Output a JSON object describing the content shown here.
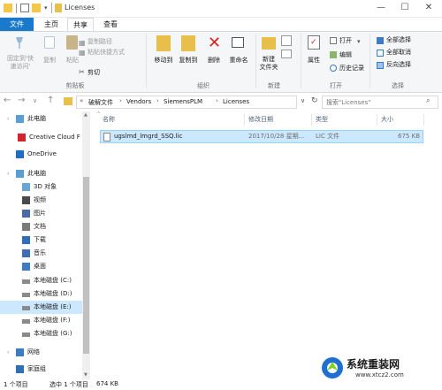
{
  "window": {
    "title": "Licenses",
    "controls": [
      "—",
      "☐",
      "✕"
    ]
  },
  "tabs": [
    {
      "label": "文件"
    },
    {
      "label": "主页"
    },
    {
      "label": "共享"
    },
    {
      "label": "查看"
    }
  ],
  "ribbon": {
    "clipboard": {
      "group_label": "剪贴板",
      "pin_label_1": "固定到'快",
      "pin_label_2": "速访问'",
      "copy_label": "复制",
      "paste_label": "粘贴",
      "cut_label": "剪切",
      "copy_path_label": "复制路径",
      "paste_shortcut_label": "粘贴快捷方式"
    },
    "organize": {
      "group_label": "组织",
      "move_to_label": "移动到",
      "copy_to_label": "复制到",
      "delete_label": "删除",
      "rename_label": "重命名"
    },
    "new": {
      "group_label": "新建",
      "new_folder_label_1": "新建",
      "new_folder_label_2": "文件夹"
    },
    "open": {
      "group_label": "打开",
      "properties_label": "属性",
      "open_label": "打开",
      "edit_label": "编辑",
      "history_label": "历史记录"
    },
    "select": {
      "group_label": "选择",
      "select_all_label": "全部选择",
      "select_none_label": "全部取消",
      "invert_label": "反向选择"
    }
  },
  "address": {
    "crumbs": [
      "破解文件",
      "Vendors",
      "SiemensPLM",
      "Licenses"
    ],
    "search_placeholder": "搜索\"Licenses\""
  },
  "nav": {
    "items": [
      {
        "label": "此电脑",
        "icon": "pc-icon"
      },
      {
        "label": "Creative Cloud F",
        "icon": "creative-cloud-icon"
      },
      {
        "label": "OneDrive",
        "icon": "onedrive-icon"
      },
      {
        "label": "此电脑",
        "icon": "pc-icon"
      },
      {
        "label": "3D 对象",
        "icon": "3d-objects-icon"
      },
      {
        "label": "视频",
        "icon": "video-icon"
      },
      {
        "label": "图片",
        "icon": "pictures-icon"
      },
      {
        "label": "文档",
        "icon": "documents-icon"
      },
      {
        "label": "下载",
        "icon": "downloads-icon"
      },
      {
        "label": "音乐",
        "icon": "music-icon"
      },
      {
        "label": "桌面",
        "icon": "desktop-icon"
      },
      {
        "label": "本地磁盘 (C:)",
        "icon": "drive-icon"
      },
      {
        "label": "本地磁盘 (D:)",
        "icon": "drive-icon"
      },
      {
        "label": "本地磁盘 (E:)",
        "icon": "drive-icon"
      },
      {
        "label": "本地磁盘 (F:)",
        "icon": "drive-icon"
      },
      {
        "label": "本地磁盘 (G:)",
        "icon": "drive-icon"
      },
      {
        "label": "网络",
        "icon": "network-icon"
      },
      {
        "label": "家庭组",
        "icon": "homegroup-icon"
      }
    ]
  },
  "columns": {
    "name": "名称",
    "date": "修改日期",
    "type": "类型",
    "size": "大小"
  },
  "files": [
    {
      "name": "ugslmd_lmgrd_SSQ.lic",
      "date": "2017/10/28 星期...",
      "type": "LIC 文件",
      "size": "675 KB"
    }
  ],
  "status": {
    "count": "1 个项目",
    "selected": "选中 1 个项目",
    "size": "674 KB"
  },
  "watermark": {
    "title": "系统重装网",
    "url": "www.xtcz2.com"
  }
}
